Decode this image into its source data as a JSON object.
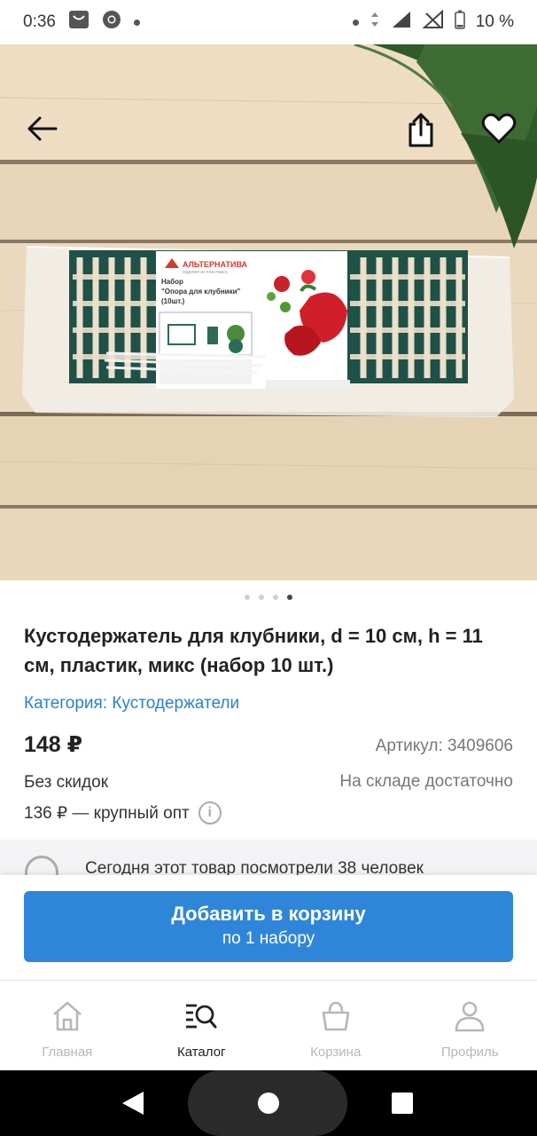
{
  "status_bar": {
    "time": "0:36",
    "battery": "10 %"
  },
  "hero": {
    "pager": {
      "count": 4,
      "active_index": 3
    },
    "package_brand": "АЛЬТЕРНАТИВА",
    "package_tagline": "изделия из пластмасс",
    "package_line1": "Набор",
    "package_line2": "\"Опора для клубники\"",
    "package_line3": "(10шт.)"
  },
  "product": {
    "title": "Кустодержатель для клубники, d = 10 см, h = 11 см, пластик, микс (набор 10 шт.)",
    "category": "Категория: Кустодержатели",
    "price": "148 ₽",
    "sku": "Артикул: 3409606",
    "discount": "Без скидок",
    "stock": "На складе достаточно",
    "wholesale": "136 ₽ — крупный опт",
    "viewers": "Сегодня этот товар посмотрели 38 человек"
  },
  "cart_button": {
    "label": "Добавить в корзину",
    "sublabel": "по 1 набору"
  },
  "bottom_nav": {
    "items": [
      {
        "label": "Главная",
        "icon": "home-icon",
        "active": false
      },
      {
        "label": "Каталог",
        "icon": "catalog-search-icon",
        "active": true
      },
      {
        "label": "Корзина",
        "icon": "basket-icon",
        "active": false
      },
      {
        "label": "Профиль",
        "icon": "profile-icon",
        "active": false
      }
    ]
  },
  "colors": {
    "accent": "#2f86d9",
    "link": "#2a7fd4",
    "nav_inactive": "#b7b7b7"
  }
}
